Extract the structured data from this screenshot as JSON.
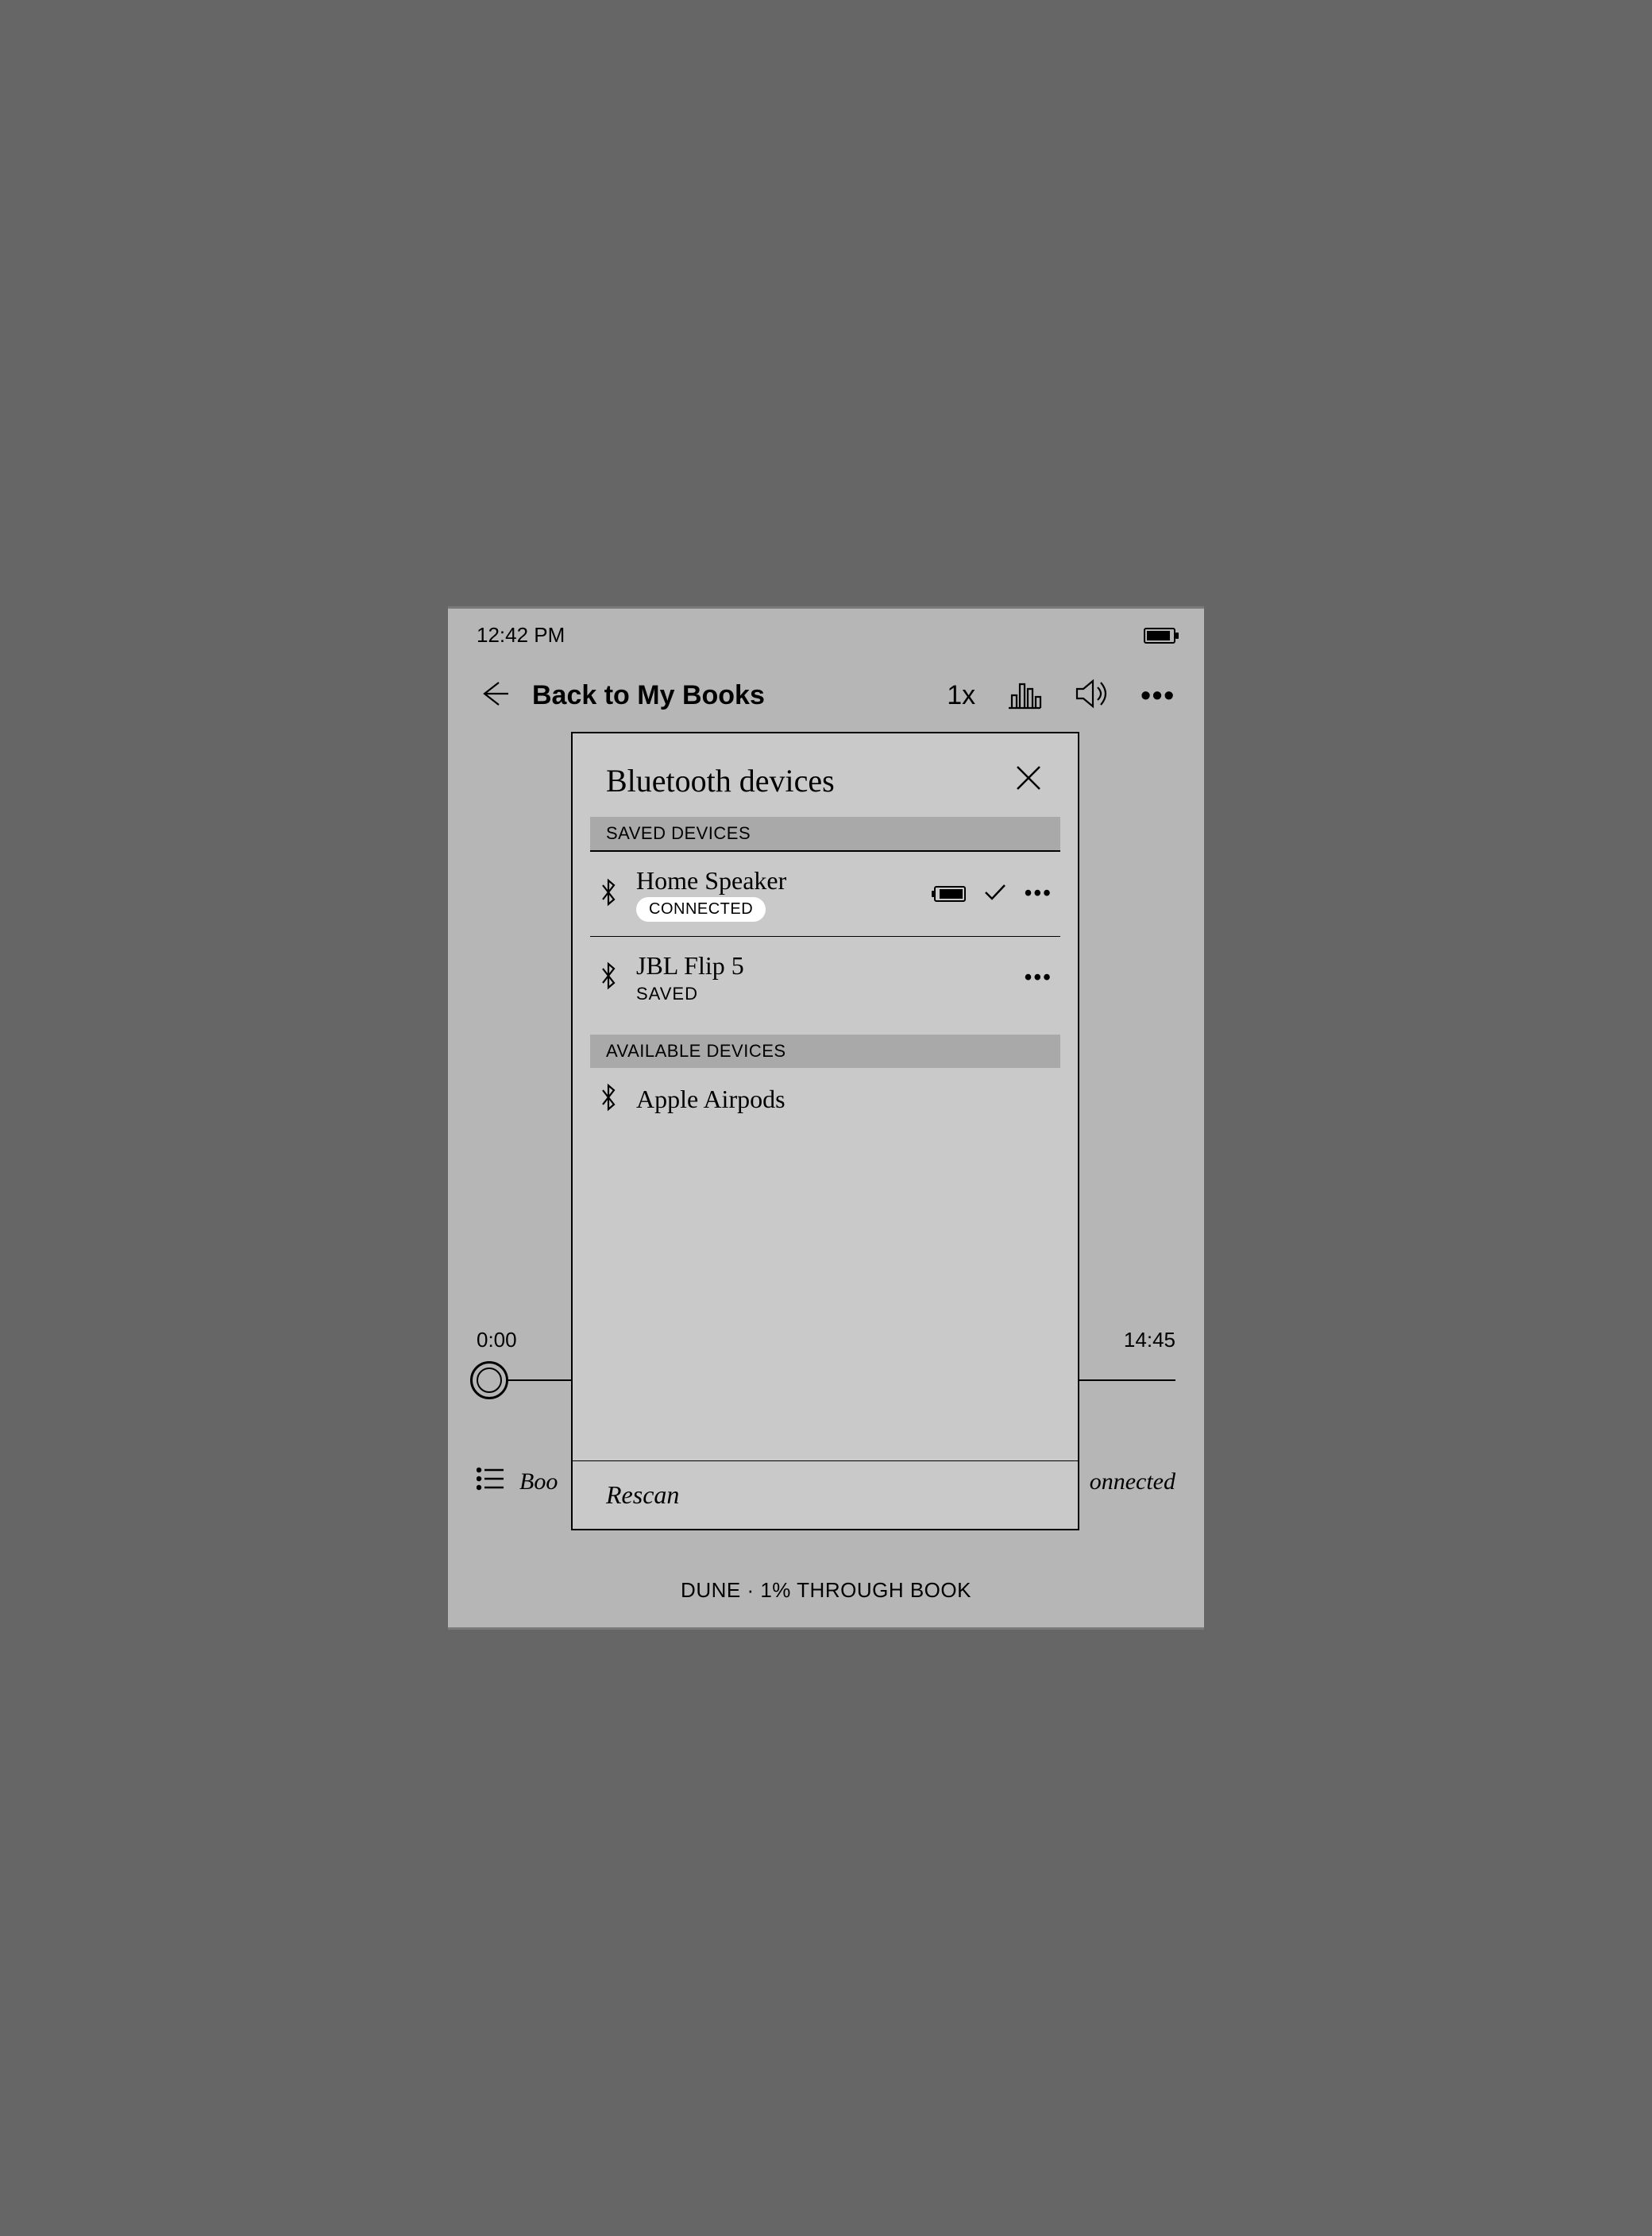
{
  "status": {
    "time": "12:42 PM"
  },
  "nav": {
    "back_label": "Back to My Books",
    "speed": "1x"
  },
  "player": {
    "elapsed": "0:00",
    "remaining": "14:45",
    "chapter_label_left": "Boo",
    "chapter_label_right": "onnected"
  },
  "footer": "DUNE · 1% THROUGH BOOK",
  "modal": {
    "title": "Bluetooth devices",
    "saved_header": "SAVED DEVICES",
    "available_header": "AVAILABLE DEVICES",
    "saved": [
      {
        "name": "Home Speaker",
        "status": "CONNECTED",
        "connected": true
      },
      {
        "name": "JBL Flip 5",
        "status": "SAVED",
        "connected": false
      }
    ],
    "available": [
      {
        "name": "Apple Airpods"
      }
    ],
    "rescan": "Rescan"
  }
}
